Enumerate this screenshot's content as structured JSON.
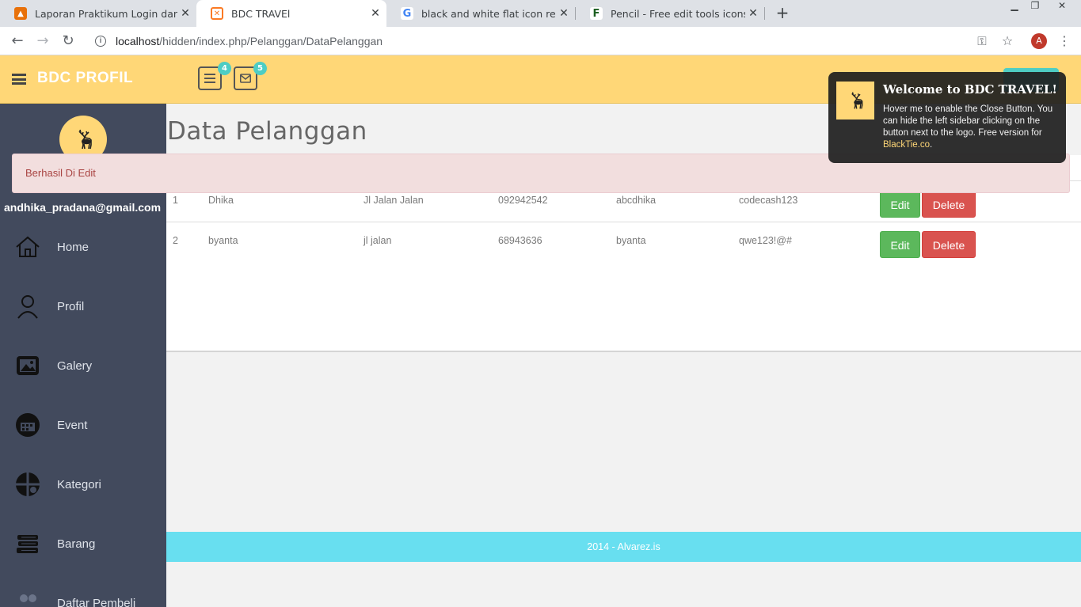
{
  "browser": {
    "tabs": [
      {
        "title": "Laporan Praktikum Login dan CR",
        "icon": "orange-doc-icon",
        "color": "#e8710a"
      },
      {
        "title": "BDC TRAVEl",
        "icon": "xampp-icon",
        "color": "#fb7a24"
      },
      {
        "title": "black and white flat icon register",
        "icon": "google-icon",
        "color": "#4285f4"
      },
      {
        "title": "Pencil - Free edit tools icons",
        "icon": "flaticon-icon",
        "color": "#1b5e20"
      }
    ],
    "url_host": "localhost",
    "url_path": "/hidden/index.php/Pelanggan/DataPelanggan",
    "profile_initial": "A"
  },
  "header": {
    "brand": "BDC PROFIL",
    "tasks_badge": "4",
    "mail_badge": "5"
  },
  "sidebar": {
    "email": "andhika_pradana@gmail.com",
    "items": [
      {
        "label": "Home",
        "icon": "home-icon"
      },
      {
        "label": "Profil",
        "icon": "user-icon"
      },
      {
        "label": "Galery",
        "icon": "gallery-icon"
      },
      {
        "label": "Event",
        "icon": "calendar-icon"
      },
      {
        "label": "Kategori",
        "icon": "category-icon"
      },
      {
        "label": "Barang",
        "icon": "books-icon"
      },
      {
        "label": "Daftar Pembeli",
        "icon": "users-icon"
      }
    ]
  },
  "main": {
    "title": "Data Pelanggan",
    "alert": "Berhasil Di Edit",
    "rows": [
      {
        "no": "1",
        "nama": "Dhika",
        "alamat": "Jl Jalan Jalan",
        "telp": "092942542",
        "username": "abcdhika",
        "password": "codecash123"
      },
      {
        "no": "2",
        "nama": "byanta",
        "alamat": "jl jalan",
        "telp": "68943636",
        "username": "byanta",
        "password": "qwe123!@#"
      }
    ],
    "edit_label": "Edit",
    "delete_label": "Delete"
  },
  "footer": {
    "text": "2014 - Alvarez.is"
  },
  "toast": {
    "title": "Welcome to BDC TRAVEL!",
    "body": "Hover me to enable the Close Button. You can hide the left sidebar clicking on the button next to the logo. Free version for ",
    "link": "BlackTie.co",
    "end": "."
  }
}
